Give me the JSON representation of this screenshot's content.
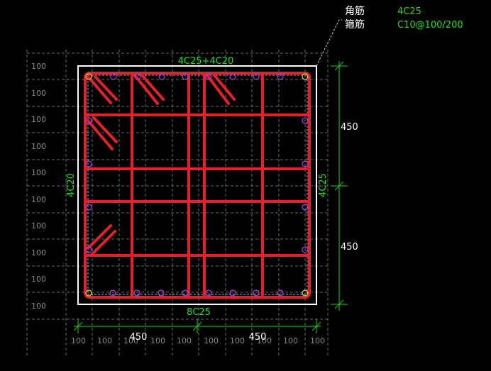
{
  "legend": {
    "corner_label": "角筋",
    "corner_value": "4C25",
    "stirrup_label": "箍筋",
    "stirrup_value": "C10@100/200"
  },
  "annotations": {
    "top_bars": "4C25+4C20",
    "bottom_bars": "8C25",
    "left_bars": "4C20",
    "right_bars": "4C25"
  },
  "dimensions": {
    "right_top": "450",
    "right_bottom": "450",
    "bottom_left": "450",
    "bottom_right": "450",
    "grid_left": [
      "100",
      "100",
      "100",
      "100",
      "100",
      "100",
      "100",
      "100",
      "100",
      "100"
    ],
    "grid_bottom": [
      "100",
      "100",
      "100",
      "100",
      "100",
      "100",
      "100",
      "100",
      "100",
      "100"
    ]
  },
  "colors": {
    "background": "#000000",
    "section_outline": "#ffffff",
    "stirrup": "#e5202a",
    "rebar_circle": "#b040d8",
    "corner_bar": "#e0d040",
    "label_green": "#22dd22",
    "dimension_green": "#22cc22",
    "grid_line": "#808080",
    "leader_line": "#cccccc"
  }
}
